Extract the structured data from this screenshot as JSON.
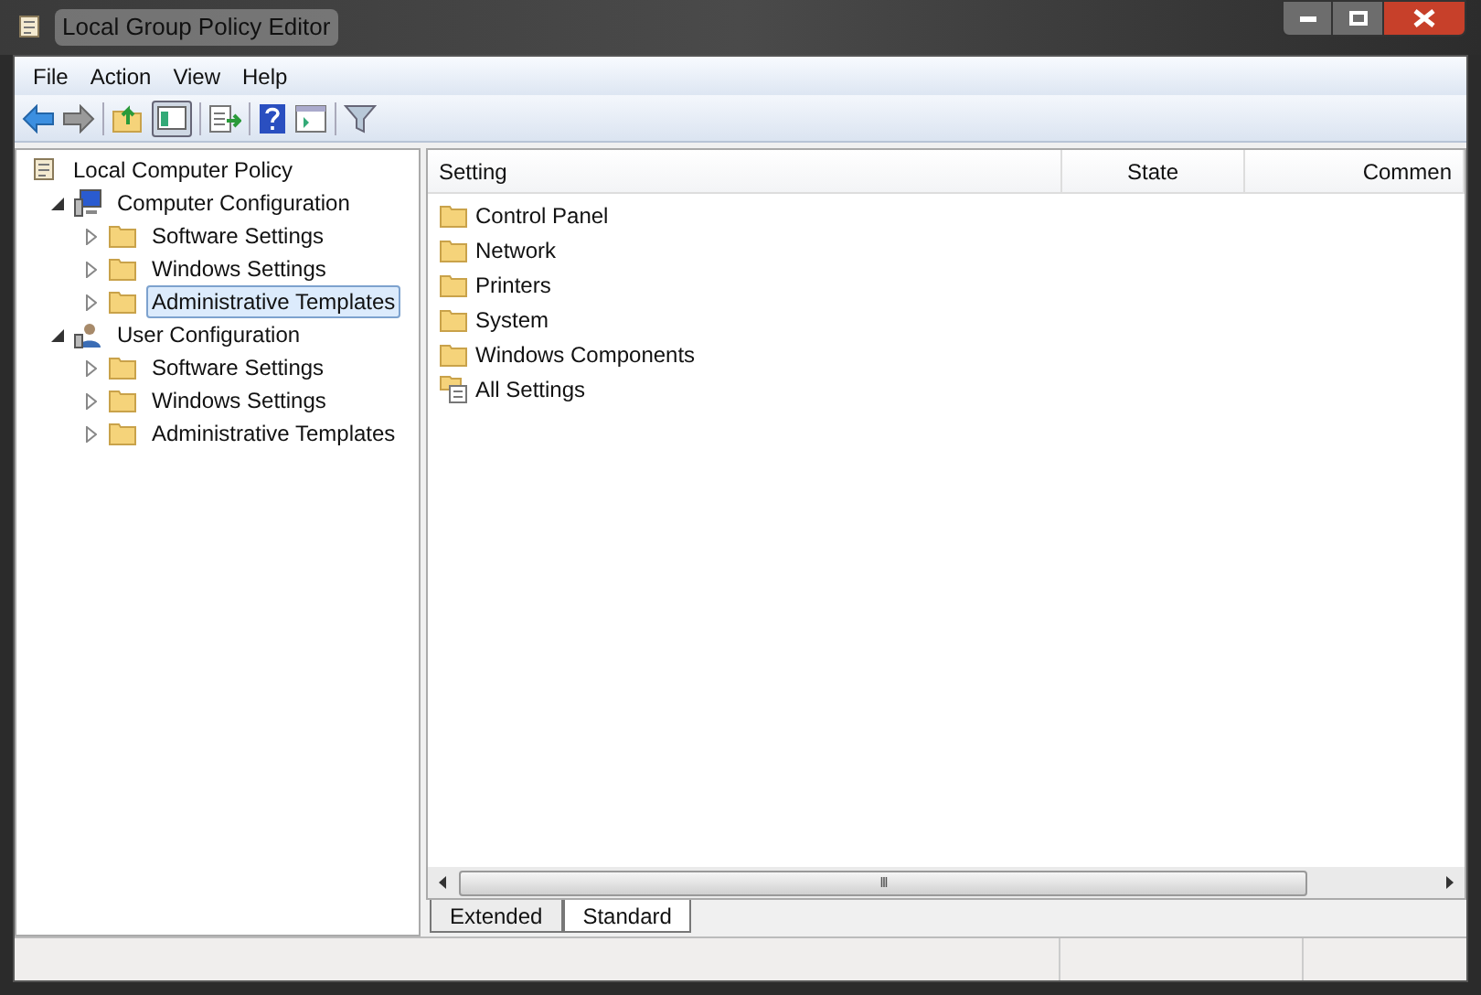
{
  "window": {
    "title": "Local Group Policy Editor"
  },
  "menu": [
    "File",
    "Action",
    "View",
    "Help"
  ],
  "tree": [
    {
      "label": "Local Computer Policy",
      "kind": "policy",
      "selected": false,
      "children": [
        {
          "label": "Computer Configuration",
          "kind": "computer",
          "expanded": true,
          "selected": false,
          "children": [
            {
              "label": "Software Settings",
              "kind": "folder",
              "expanded": false,
              "selected": false
            },
            {
              "label": "Windows Settings",
              "kind": "folder",
              "expanded": false,
              "selected": false
            },
            {
              "label": "Administrative Templates",
              "kind": "folder",
              "expanded": false,
              "selected": true
            }
          ]
        },
        {
          "label": "User Configuration",
          "kind": "user",
          "expanded": true,
          "selected": false,
          "children": [
            {
              "label": "Software Settings",
              "kind": "folder",
              "expanded": false,
              "selected": false
            },
            {
              "label": "Windows Settings",
              "kind": "folder",
              "expanded": false,
              "selected": false
            },
            {
              "label": "Administrative Templates",
              "kind": "folder",
              "expanded": false,
              "selected": false
            }
          ]
        }
      ]
    }
  ],
  "table": {
    "columns": [
      "Setting",
      "State",
      "Commen"
    ],
    "rows": [
      {
        "name": "Control Panel",
        "kind": "folder"
      },
      {
        "name": "Network",
        "kind": "folder"
      },
      {
        "name": "Printers",
        "kind": "folder"
      },
      {
        "name": "System",
        "kind": "folder"
      },
      {
        "name": "Windows Components",
        "kind": "folder"
      },
      {
        "name": "All Settings",
        "kind": "settings"
      }
    ]
  },
  "scroll_grip": "III",
  "view_tabs": [
    {
      "label": "Extended",
      "selected": false
    },
    {
      "label": "Standard",
      "selected": true
    }
  ]
}
